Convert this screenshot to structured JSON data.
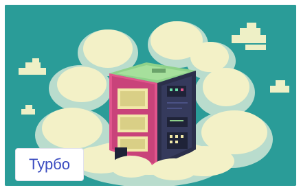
{
  "card": {
    "tag_label": "Турбо",
    "illustration": "pixel-art-server-in-clouds",
    "colors": {
      "background": "#2a9c98",
      "cloud_light": "#f3f1c7",
      "cloud_shadow": "#b9dccd",
      "server_pink": "#e0558c",
      "server_dark": "#2b2f4a",
      "server_top": "#8fd28a",
      "tag_text": "#3b4cc0"
    }
  }
}
